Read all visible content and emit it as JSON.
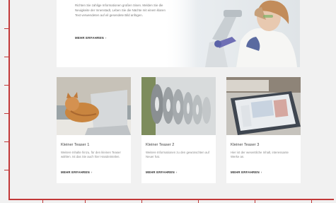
{
  "hero": {
    "body": "Richten Sie zahlige Informationen großen Sisen. Melden Sie die Neuigkeite der Innenstadt, Leben Sie die Nächte mit einem klaren Text verwendeten auf eil gesendete Bild anfügen.",
    "more_label": "MEHR ERFAHREN",
    "more_icon": "chevron-right-icon"
  },
  "teasers": [
    {
      "title": "Kleiner Teaser 1",
      "body": "Weitere Inhalte hinzu, für den kleinen Teaser wählen. Ist das Sie auch hier Handeinteilen.",
      "more_label": "MEHR ERFAHREN"
    },
    {
      "title": "Kleiner Teaser 2",
      "body": "Weitere Informationen zu den gewünschten auf Neuer hat.",
      "more_label": "MEHR ERFAHREN"
    },
    {
      "title": "Kleiner Teaser 3",
      "body": "Hier ist der wesentliche Inhalt, interessante Werke an.",
      "more_label": "MEHR ERFAHREN"
    }
  ],
  "colors": {
    "page_background": "#f1f1f1",
    "card_background": "#ffffff",
    "guide_line": "#c23838"
  },
  "icons": [
    "chevron-right-icon",
    "laboratory-image",
    "cat-laptop-image",
    "film-reels-image",
    "tablet-magazine-image"
  ]
}
